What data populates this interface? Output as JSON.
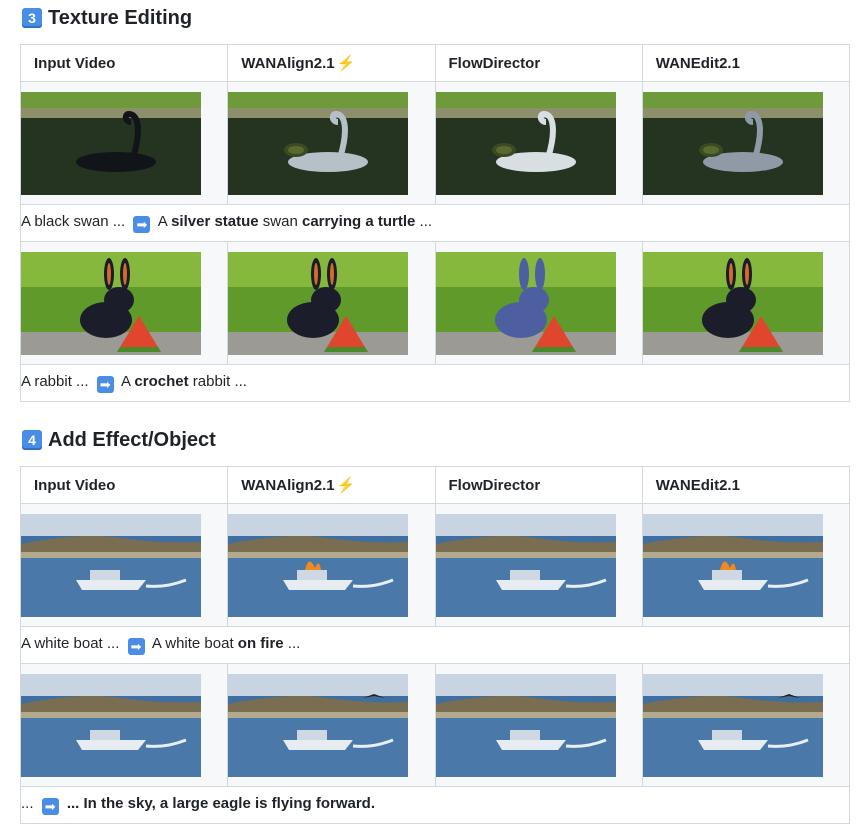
{
  "sections": [
    {
      "number": "3",
      "title": "Texture Editing",
      "columns": [
        "Input Video",
        "WANAlign2.1",
        "FlowDirector",
        "WANEdit2.1"
      ],
      "bolt_icon": "⚡",
      "rows": [
        {
          "scene": "swan",
          "caption_pre": "A black swan ...",
          "caption_parts": [
            {
              "text": " A ",
              "bold": false
            },
            {
              "text": "silver statue",
              "bold": true
            },
            {
              "text": " swan ",
              "bold": false
            },
            {
              "text": "carrying a turtle",
              "bold": true
            },
            {
              "text": " ...",
              "bold": false
            }
          ]
        },
        {
          "scene": "rabbit",
          "caption_pre": "A rabbit ...",
          "caption_parts": [
            {
              "text": " A ",
              "bold": false
            },
            {
              "text": "crochet",
              "bold": true
            },
            {
              "text": " rabbit ...",
              "bold": false
            }
          ]
        }
      ]
    },
    {
      "number": "4",
      "title": "Add Effect/Object",
      "columns": [
        "Input Video",
        "WANAlign2.1",
        "FlowDirector",
        "WANEdit2.1"
      ],
      "bolt_icon": "⚡",
      "rows": [
        {
          "scene": "boat",
          "caption_pre": "A white boat ...",
          "caption_parts": [
            {
              "text": " A white boat ",
              "bold": false
            },
            {
              "text": "on fire",
              "bold": true
            },
            {
              "text": " ...",
              "bold": false
            }
          ]
        },
        {
          "scene": "boat2",
          "caption_pre": "...",
          "caption_parts": [
            {
              "text": " ... In the sky, a large eagle is flying forward.",
              "bold": true
            }
          ]
        }
      ]
    }
  ],
  "colors": {
    "keycap": "#4a8de6",
    "bolt": "#f0883e",
    "border": "#d1d9e0"
  },
  "icons": {
    "arrow": "right-arrow-icon",
    "bolt": "lightning-icon"
  }
}
